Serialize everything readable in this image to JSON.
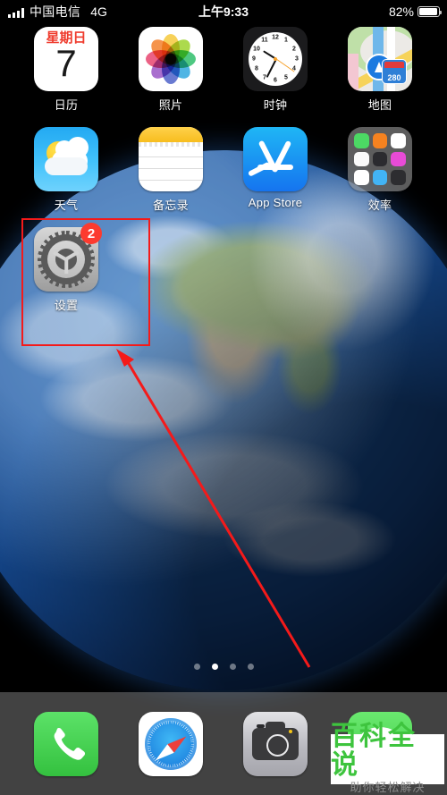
{
  "status_bar": {
    "signal_icon": "signal-bars-icon",
    "carrier": "中国电信",
    "network": "4G",
    "time": "上午9:33",
    "battery_percent": "82%",
    "battery_icon": "battery-icon"
  },
  "home_screen": {
    "rows": [
      [
        {
          "name": "calendar",
          "label": "日历",
          "icon": "calendar-icon",
          "weekday": "星期日",
          "day": "7"
        },
        {
          "name": "photos",
          "label": "照片",
          "icon": "photos-icon"
        },
        {
          "name": "clock",
          "label": "时钟",
          "icon": "clock-icon",
          "numbers": [
            "12",
            "1",
            "2",
            "3",
            "4",
            "5",
            "6",
            "7",
            "8",
            "9",
            "10",
            "11"
          ]
        },
        {
          "name": "maps",
          "label": "地图",
          "icon": "maps-icon",
          "shield": "280"
        }
      ],
      [
        {
          "name": "weather",
          "label": "天气",
          "icon": "weather-icon"
        },
        {
          "name": "notes",
          "label": "备忘录",
          "icon": "notes-icon"
        },
        {
          "name": "app-store",
          "label": "App Store",
          "icon": "app-store-icon"
        },
        {
          "name": "productivity-folder",
          "label": "效率",
          "icon": "folder-icon",
          "folder_apps": [
            "facetime",
            "books",
            "health",
            "home",
            "stocks",
            "itunes-store",
            "reminders",
            "mail",
            "wallet"
          ]
        }
      ],
      [
        {
          "name": "settings",
          "label": "设置",
          "icon": "settings-gear-icon",
          "badge": "2"
        }
      ]
    ],
    "page_dots": {
      "count": 4,
      "active_index": 1
    }
  },
  "dock": {
    "items": [
      {
        "name": "phone",
        "icon": "phone-icon"
      },
      {
        "name": "safari",
        "icon": "safari-compass-icon"
      },
      {
        "name": "camera",
        "icon": "camera-icon"
      },
      {
        "name": "messages",
        "icon": "messages-icon"
      }
    ]
  },
  "annotations": {
    "highlight_box": {
      "label": "settings-highlight-box",
      "color": "#f41a1a"
    },
    "arrow": {
      "label": "pointer-arrow",
      "color": "#f41a1a"
    }
  },
  "watermark": {
    "title": "百科全说",
    "subtitle": "助你轻松解决",
    "title_color": "#3ec43e",
    "subtitle_color": "#8b8b8b"
  },
  "colors": {
    "badge_red": "#fc3b2f",
    "annotation_red": "#f41a1a",
    "dock_bg": "rgba(120,120,120,.55)"
  }
}
